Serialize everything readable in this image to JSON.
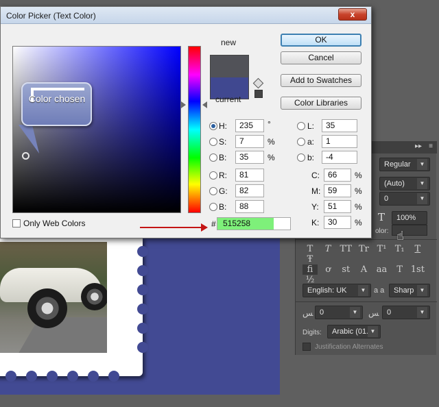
{
  "dialog": {
    "title": "Color Picker (Text Color)",
    "close_label": "x",
    "new_label": "new",
    "current_label": "current",
    "buttons": {
      "ok": "OK",
      "cancel": "Cancel",
      "add_to_swatches": "Add to Swatches",
      "color_libraries": "Color Libraries"
    },
    "only_web_colors_label": "Only Web Colors",
    "hex_prefix": "#",
    "hex_value": "515258",
    "fields_left": [
      {
        "label": "H:",
        "value": "235",
        "unit": "°",
        "selected": true
      },
      {
        "label": "S:",
        "value": "7",
        "unit": "%",
        "selected": false
      },
      {
        "label": "B:",
        "value": "35",
        "unit": "%",
        "selected": false
      },
      {
        "label": "R:",
        "value": "81",
        "unit": "",
        "selected": false
      },
      {
        "label": "G:",
        "value": "82",
        "unit": "",
        "selected": false
      },
      {
        "label": "B:",
        "value": "88",
        "unit": "",
        "selected": false
      }
    ],
    "fields_lab": [
      {
        "label": "L:",
        "value": "35"
      },
      {
        "label": "a:",
        "value": "1"
      },
      {
        "label": "b:",
        "value": "-4"
      }
    ],
    "fields_cmyk": [
      {
        "label": "C:",
        "value": "66",
        "unit": "%"
      },
      {
        "label": "M:",
        "value": "59",
        "unit": "%"
      },
      {
        "label": "Y:",
        "value": "51",
        "unit": "%"
      },
      {
        "label": "K:",
        "value": "30",
        "unit": "%"
      }
    ],
    "colors": {
      "new_swatch": "#515258",
      "current_swatch": "#404890",
      "hex_highlight": "#7ef07a"
    }
  },
  "callout": {
    "text": "Color chosen"
  },
  "character_panel": {
    "font_style": "Regular",
    "leading": "(Auto)",
    "tracking": "0",
    "vertical_scale": "100%",
    "color_label": "olor:",
    "language": "English: UK",
    "antialias_label": "a a",
    "antialias": "Sharp",
    "kashida_left": "0",
    "kashida_right": "0",
    "digits_label": "Digits:",
    "digits_value": "Arabic (01...",
    "justification_alternates": "Justification Alternates",
    "style_buttons_row1": [
      "T",
      "T",
      "TT",
      "Tr",
      "T¹",
      "T₁",
      "T",
      "Ŧ"
    ],
    "style_buttons_row2": [
      "fi",
      "ơ",
      "st",
      "A",
      "aa",
      "T",
      "1st",
      "½"
    ]
  }
}
